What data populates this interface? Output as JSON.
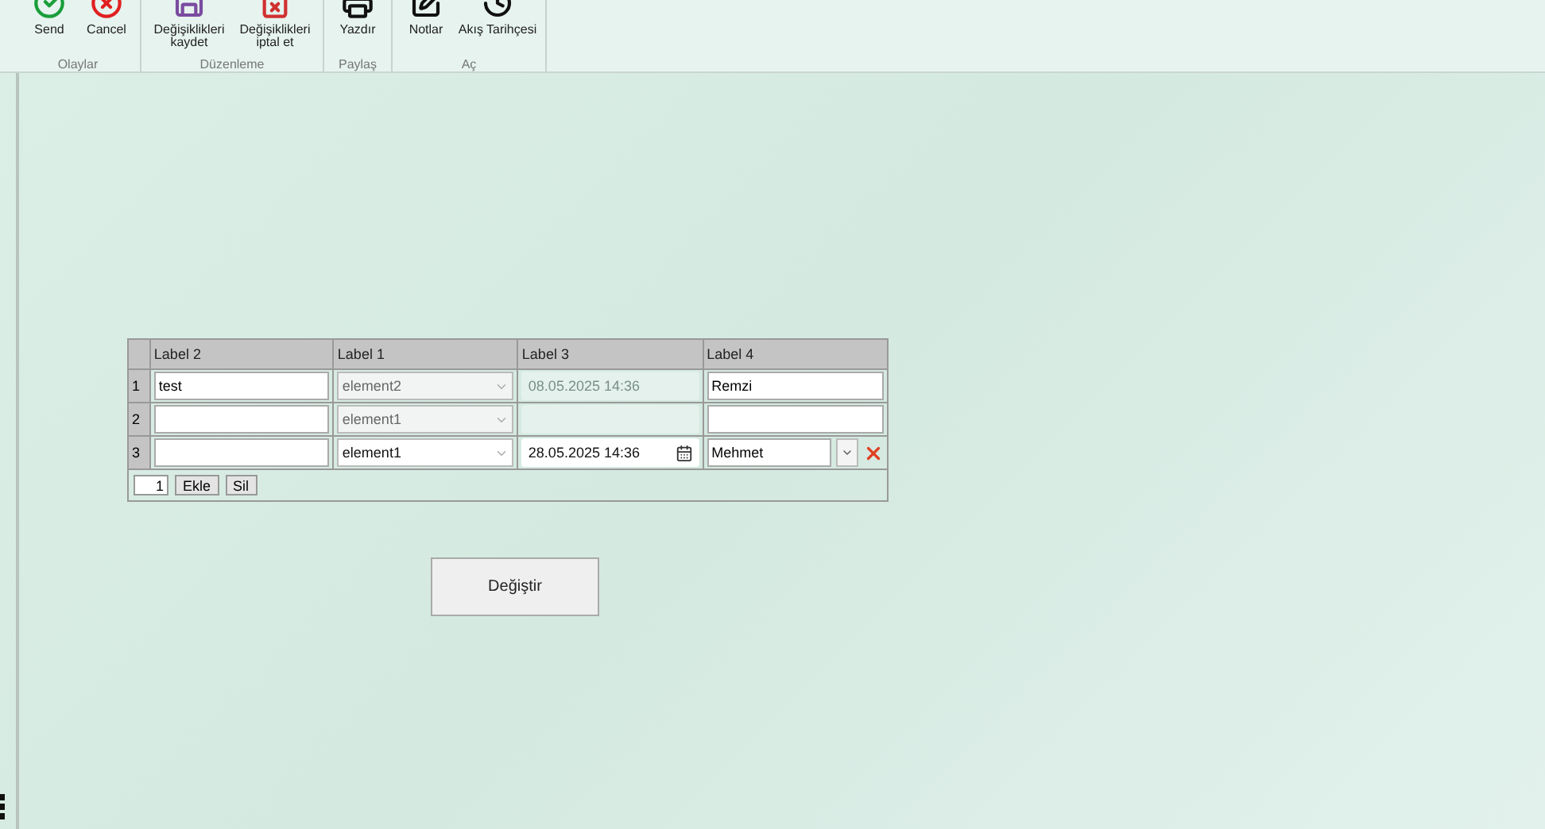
{
  "ribbon": {
    "groups": [
      {
        "label": "Olaylar",
        "buttons": [
          {
            "label": "Send",
            "kind": "send"
          },
          {
            "label": "Cancel",
            "kind": "cancel"
          }
        ]
      },
      {
        "label": "Düzenleme",
        "buttons": [
          {
            "label": "Değişiklikleri kaydet",
            "kind": "save"
          },
          {
            "label": "Değişiklikleri iptal et",
            "kind": "discard"
          }
        ]
      },
      {
        "label": "Paylaş",
        "buttons": [
          {
            "label": "Yazdır",
            "kind": "print"
          }
        ]
      },
      {
        "label": "Aç",
        "buttons": [
          {
            "label": "Notlar",
            "kind": "notes"
          },
          {
            "label": "Akış Tarihçesi",
            "kind": "history"
          }
        ]
      }
    ]
  },
  "grid": {
    "columns": [
      "Label 2",
      "Label 1",
      "Label 3",
      "Label 4"
    ],
    "rows": [
      {
        "number": "1",
        "text": "test",
        "select": {
          "value": "element2",
          "disabled": true
        },
        "date": {
          "value": "08.05.2025 14:36",
          "disabled": true
        },
        "person": {
          "value": "Remzi",
          "kind": "text"
        }
      },
      {
        "number": "2",
        "select": {
          "value": "element1",
          "disabled": true
        },
        "date": {
          "disabled": true
        },
        "person": {
          "kind": "text"
        }
      },
      {
        "number": "3",
        "select": {
          "value": "element1",
          "disabled": false
        },
        "date": {
          "value": "28.05.2025 14:36",
          "disabled": false
        },
        "person": {
          "value": "Mehmet",
          "kind": "combo"
        }
      }
    ],
    "footer": {
      "count": "1",
      "buttons": [
        "Ekle",
        "Sil"
      ]
    }
  },
  "submit": "Değiştir"
}
